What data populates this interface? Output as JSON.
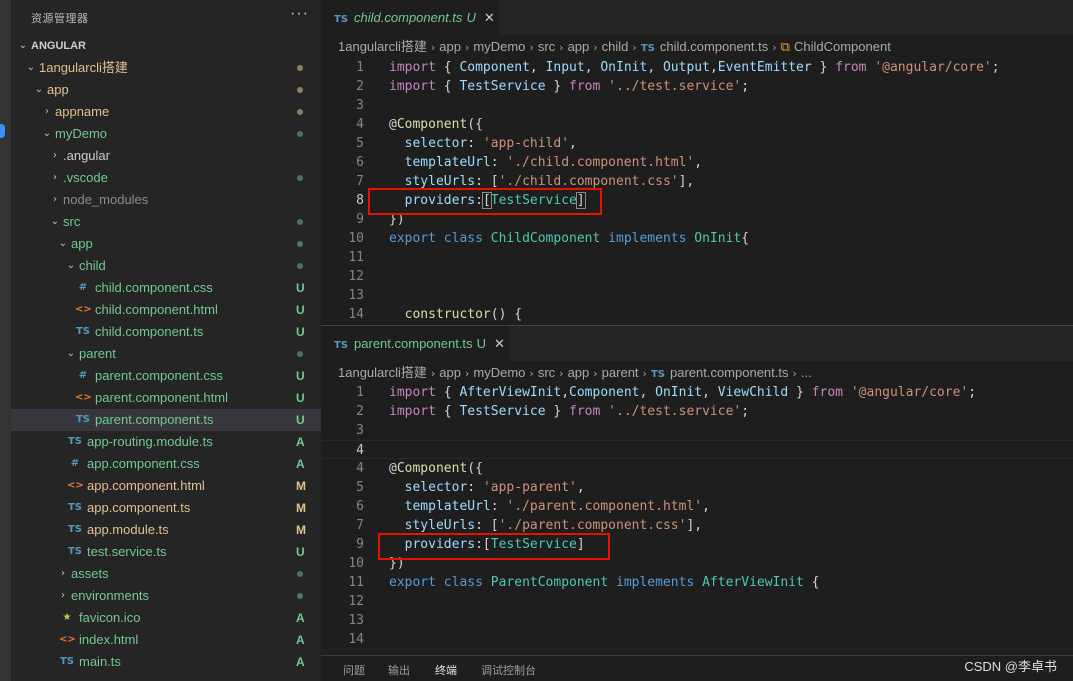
{
  "explorer": {
    "title": "资源管理器",
    "more": "···"
  },
  "tree": [
    {
      "label": "ANGULAR",
      "chev": "⌄",
      "depth": 0,
      "kind": "root",
      "color": "#cccccc",
      "deco": "none"
    },
    {
      "label": "1angularcli搭建",
      "chev": "⌄",
      "depth": 1,
      "kind": "folder",
      "color": "#e2c08d",
      "deco": "dot",
      "deco_color": "#8f7f5f"
    },
    {
      "label": "app",
      "chev": "⌄",
      "depth": 2,
      "kind": "folder",
      "color": "#e2c08d",
      "deco": "dot",
      "deco_color": "#8f7f5f"
    },
    {
      "label": "appname",
      "chev": "›",
      "depth": 3,
      "kind": "folder",
      "color": "#e2c08d",
      "deco": "dot",
      "deco_color": "#8f7f5f"
    },
    {
      "label": "myDemo",
      "chev": "⌄",
      "depth": 3,
      "kind": "folder",
      "color": "#73c991",
      "deco": "dot",
      "deco_color": "#4b7a5a"
    },
    {
      "label": ".angular",
      "chev": "›",
      "depth": 4,
      "kind": "folder",
      "color": "#cccccc",
      "deco": "none"
    },
    {
      "label": ".vscode",
      "chev": "›",
      "depth": 4,
      "kind": "folder",
      "color": "#73c991",
      "deco": "dot",
      "deco_color": "#4b7a5a"
    },
    {
      "label": "node_modules",
      "chev": "›",
      "depth": 4,
      "kind": "folder",
      "color": "#8c8c8c",
      "deco": "none"
    },
    {
      "label": "src",
      "chev": "⌄",
      "depth": 4,
      "kind": "folder",
      "color": "#73c991",
      "deco": "dot",
      "deco_color": "#4b7a5a"
    },
    {
      "label": "app",
      "chev": "⌄",
      "depth": 5,
      "kind": "folder",
      "color": "#73c991",
      "deco": "dot",
      "deco_color": "#4b7a5a"
    },
    {
      "label": "child",
      "chev": "⌄",
      "depth": 6,
      "kind": "folder",
      "color": "#73c991",
      "deco": "dot",
      "deco_color": "#4b7a5a"
    },
    {
      "label": "child.component.css",
      "icon": "#",
      "icon_color": "#519aba",
      "depth": 7,
      "kind": "file",
      "color": "#73c991",
      "deco": "badge",
      "badge": "U",
      "deco_color": "#73c991"
    },
    {
      "label": "child.component.html",
      "icon": "<>",
      "icon_color": "#e37933",
      "depth": 7,
      "kind": "file",
      "color": "#73c991",
      "deco": "badge",
      "badge": "U",
      "deco_color": "#73c991"
    },
    {
      "label": "child.component.ts",
      "icon": "TS",
      "icon_color": "#519aba",
      "depth": 7,
      "kind": "file",
      "color": "#73c991",
      "deco": "badge",
      "badge": "U",
      "deco_color": "#73c991"
    },
    {
      "label": "parent",
      "chev": "⌄",
      "depth": 6,
      "kind": "folder",
      "color": "#73c991",
      "deco": "dot",
      "deco_color": "#4b7a5a"
    },
    {
      "label": "parent.component.css",
      "icon": "#",
      "icon_color": "#519aba",
      "depth": 7,
      "kind": "file",
      "color": "#73c991",
      "deco": "badge",
      "badge": "U",
      "deco_color": "#73c991"
    },
    {
      "label": "parent.component.html",
      "icon": "<>",
      "icon_color": "#e37933",
      "depth": 7,
      "kind": "file",
      "color": "#73c991",
      "deco": "badge",
      "badge": "U",
      "deco_color": "#73c991"
    },
    {
      "label": "parent.component.ts",
      "icon": "TS",
      "icon_color": "#519aba",
      "depth": 7,
      "kind": "file",
      "color": "#73c991",
      "deco": "badge",
      "badge": "U",
      "deco_color": "#73c991",
      "selected": true
    },
    {
      "label": "app-routing.module.ts",
      "icon": "TS",
      "icon_color": "#519aba",
      "depth": 6,
      "kind": "file",
      "color": "#73c991",
      "deco": "badge",
      "badge": "A",
      "deco_color": "#73c991"
    },
    {
      "label": "app.component.css",
      "icon": "#",
      "icon_color": "#519aba",
      "depth": 6,
      "kind": "file",
      "color": "#73c991",
      "deco": "badge",
      "badge": "A",
      "deco_color": "#73c991"
    },
    {
      "label": "app.component.html",
      "icon": "<>",
      "icon_color": "#e37933",
      "depth": 6,
      "kind": "file",
      "color": "#e2c08d",
      "deco": "badge",
      "badge": "M",
      "deco_color": "#e2c08d"
    },
    {
      "label": "app.component.ts",
      "icon": "TS",
      "icon_color": "#519aba",
      "depth": 6,
      "kind": "file",
      "color": "#e2c08d",
      "deco": "badge",
      "badge": "M",
      "deco_color": "#e2c08d"
    },
    {
      "label": "app.module.ts",
      "icon": "TS",
      "icon_color": "#519aba",
      "depth": 6,
      "kind": "file",
      "color": "#e2c08d",
      "deco": "badge",
      "badge": "M",
      "deco_color": "#e2c08d"
    },
    {
      "label": "test.service.ts",
      "icon": "TS",
      "icon_color": "#519aba",
      "depth": 6,
      "kind": "file",
      "color": "#73c991",
      "deco": "badge",
      "badge": "U",
      "deco_color": "#73c991"
    },
    {
      "label": "assets",
      "chev": "›",
      "depth": 5,
      "kind": "folder",
      "color": "#73c991",
      "deco": "dot",
      "deco_color": "#4b7a5a"
    },
    {
      "label": "environments",
      "chev": "›",
      "depth": 5,
      "kind": "folder",
      "color": "#73c991",
      "deco": "dot",
      "deco_color": "#4b7a5a"
    },
    {
      "label": "favicon.ico",
      "icon": "★",
      "icon_color": "#cbcb41",
      "depth": 5,
      "kind": "file",
      "color": "#73c991",
      "deco": "badge",
      "badge": "A",
      "deco_color": "#73c991"
    },
    {
      "label": "index.html",
      "icon": "<>",
      "icon_color": "#e37933",
      "depth": 5,
      "kind": "file",
      "color": "#73c991",
      "deco": "badge",
      "badge": "A",
      "deco_color": "#73c991"
    },
    {
      "label": "main.ts",
      "icon": "TS",
      "icon_color": "#519aba",
      "depth": 5,
      "kind": "file",
      "color": "#73c991",
      "deco": "badge",
      "badge": "A",
      "deco_color": "#73c991"
    }
  ],
  "top_editor": {
    "tab": {
      "icon": "TS",
      "name": "child.component.ts",
      "status": "U",
      "close": "✕"
    },
    "breadcrumb": [
      "1angularcli搭建",
      "app",
      "myDemo",
      "src",
      "app",
      "child"
    ],
    "breadcrumb_file": "child.component.ts",
    "breadcrumb_symbol": "ChildComponent",
    "active_line": 8,
    "lines": [
      {
        "n": 1,
        "parts": [
          [
            "kc",
            "import"
          ],
          [
            "punc",
            " { "
          ],
          [
            "id",
            "Component"
          ],
          [
            "punc",
            ", "
          ],
          [
            "id",
            "Input"
          ],
          [
            "punc",
            ", "
          ],
          [
            "id",
            "OnInit"
          ],
          [
            "punc",
            ", "
          ],
          [
            "id",
            "Output"
          ],
          [
            "punc",
            ","
          ],
          [
            "id",
            "EventEmitter"
          ],
          [
            "punc",
            " } "
          ],
          [
            "kc",
            "from"
          ],
          [
            "punc",
            " "
          ],
          [
            "str",
            "'@angular/core'"
          ],
          [
            "punc",
            ";"
          ]
        ]
      },
      {
        "n": 2,
        "parts": [
          [
            "kc",
            "import"
          ],
          [
            "punc",
            " { "
          ],
          [
            "id",
            "TestService"
          ],
          [
            "punc",
            " } "
          ],
          [
            "kc",
            "from"
          ],
          [
            "punc",
            " "
          ],
          [
            "str",
            "'../test.service'"
          ],
          [
            "punc",
            ";"
          ]
        ]
      },
      {
        "n": 3,
        "parts": []
      },
      {
        "n": 4,
        "parts": [
          [
            "punc",
            "@"
          ],
          [
            "fn",
            "Component"
          ],
          [
            "punc",
            "({"
          ]
        ]
      },
      {
        "n": 5,
        "parts": [
          [
            "punc",
            "  "
          ],
          [
            "id",
            "selector"
          ],
          [
            "punc",
            ": "
          ],
          [
            "str",
            "'app-child'"
          ],
          [
            "punc",
            ","
          ]
        ]
      },
      {
        "n": 6,
        "parts": [
          [
            "punc",
            "  "
          ],
          [
            "id",
            "templateUrl"
          ],
          [
            "punc",
            ": "
          ],
          [
            "str",
            "'./child.component.html'"
          ],
          [
            "punc",
            ","
          ]
        ]
      },
      {
        "n": 7,
        "parts": [
          [
            "punc",
            "  "
          ],
          [
            "id",
            "styleUrls"
          ],
          [
            "punc",
            ": ["
          ],
          [
            "str",
            "'./child.component.css'"
          ],
          [
            "punc",
            "],"
          ]
        ]
      },
      {
        "n": 8,
        "parts": [
          [
            "punc",
            "  "
          ],
          [
            "id",
            "providers"
          ],
          [
            "punc",
            ":"
          ],
          [
            "bracket",
            "["
          ],
          [
            "cls",
            "TestService"
          ],
          [
            "bracket",
            "]"
          ]
        ]
      },
      {
        "n": 9,
        "parts": [
          [
            "punc",
            "})"
          ]
        ]
      },
      {
        "n": 10,
        "parts": [
          [
            "kw",
            "export"
          ],
          [
            "punc",
            " "
          ],
          [
            "kw",
            "class"
          ],
          [
            "punc",
            " "
          ],
          [
            "cls",
            "ChildComponent"
          ],
          [
            "punc",
            " "
          ],
          [
            "kw",
            "implements"
          ],
          [
            "punc",
            " "
          ],
          [
            "cls",
            "OnInit"
          ],
          [
            "punc",
            "{"
          ]
        ]
      },
      {
        "n": 11,
        "parts": []
      },
      {
        "n": 12,
        "parts": []
      },
      {
        "n": 13,
        "parts": []
      },
      {
        "n": 14,
        "parts": [
          [
            "punc",
            "  "
          ],
          [
            "fn",
            "constructor"
          ],
          [
            "punc",
            "() {"
          ]
        ]
      }
    ]
  },
  "bottom_editor": {
    "tab": {
      "icon": "TS",
      "name": "parent.component.ts",
      "status": "U",
      "close": "✕"
    },
    "breadcrumb": [
      "1angularcli搭建",
      "app",
      "myDemo",
      "src",
      "app",
      "parent"
    ],
    "breadcrumb_file": "parent.component.ts",
    "breadcrumb_tail": "...",
    "active_line": 4,
    "lines": [
      {
        "n": 1,
        "parts": [
          [
            "kc",
            "import"
          ],
          [
            "punc",
            " { "
          ],
          [
            "id",
            "AfterViewInit"
          ],
          [
            "punc",
            ","
          ],
          [
            "id",
            "Component"
          ],
          [
            "punc",
            ", "
          ],
          [
            "id",
            "OnInit"
          ],
          [
            "punc",
            ", "
          ],
          [
            "id",
            "ViewChild"
          ],
          [
            "punc",
            " } "
          ],
          [
            "kc",
            "from"
          ],
          [
            "punc",
            " "
          ],
          [
            "str",
            "'@angular/core'"
          ],
          [
            "punc",
            ";"
          ]
        ]
      },
      {
        "n": 2,
        "parts": [
          [
            "kc",
            "import"
          ],
          [
            "punc",
            " { "
          ],
          [
            "id",
            "TestService"
          ],
          [
            "punc",
            " } "
          ],
          [
            "kc",
            "from"
          ],
          [
            "punc",
            " "
          ],
          [
            "str",
            "'../test.service'"
          ],
          [
            "punc",
            ";"
          ]
        ]
      },
      {
        "n": 3,
        "parts": []
      },
      {
        "n": 4,
        "parts": []
      },
      {
        "n": 4,
        "parts": [
          [
            "punc",
            "@"
          ],
          [
            "fn",
            "Component"
          ],
          [
            "punc",
            "({"
          ]
        ]
      },
      {
        "n": 5,
        "parts": [
          [
            "punc",
            "  "
          ],
          [
            "id",
            "selector"
          ],
          [
            "punc",
            ": "
          ],
          [
            "str",
            "'app-parent'"
          ],
          [
            "punc",
            ","
          ]
        ]
      },
      {
        "n": 6,
        "parts": [
          [
            "punc",
            "  "
          ],
          [
            "id",
            "templateUrl"
          ],
          [
            "punc",
            ": "
          ],
          [
            "str",
            "'./parent.component.html'"
          ],
          [
            "punc",
            ","
          ]
        ]
      },
      {
        "n": 7,
        "parts": [
          [
            "punc",
            "  "
          ],
          [
            "id",
            "styleUrls"
          ],
          [
            "punc",
            ": ["
          ],
          [
            "str",
            "'./parent.component.css'"
          ],
          [
            "punc",
            "],"
          ]
        ]
      },
      {
        "n": 9,
        "parts": [
          [
            "punc",
            "  "
          ],
          [
            "id",
            "providers"
          ],
          [
            "punc",
            ":["
          ],
          [
            "cls",
            "TestService"
          ],
          [
            "punc",
            "]"
          ]
        ]
      },
      {
        "n": 10,
        "parts": [
          [
            "punc",
            "})"
          ]
        ]
      },
      {
        "n": 11,
        "parts": [
          [
            "kw",
            "export"
          ],
          [
            "punc",
            " "
          ],
          [
            "kw",
            "class"
          ],
          [
            "punc",
            " "
          ],
          [
            "cls",
            "ParentComponent"
          ],
          [
            "punc",
            " "
          ],
          [
            "kw",
            "implements"
          ],
          [
            "punc",
            " "
          ],
          [
            "cls",
            "AfterViewInit"
          ],
          [
            "punc",
            " {"
          ]
        ]
      },
      {
        "n": 12,
        "parts": []
      },
      {
        "n": 13,
        "parts": []
      },
      {
        "n": 14,
        "parts": []
      }
    ]
  },
  "panel": {
    "tabs": [
      "问题",
      "输出",
      "终端",
      "调试控制台"
    ],
    "active": 2
  },
  "watermark": "CSDN @李卓书"
}
